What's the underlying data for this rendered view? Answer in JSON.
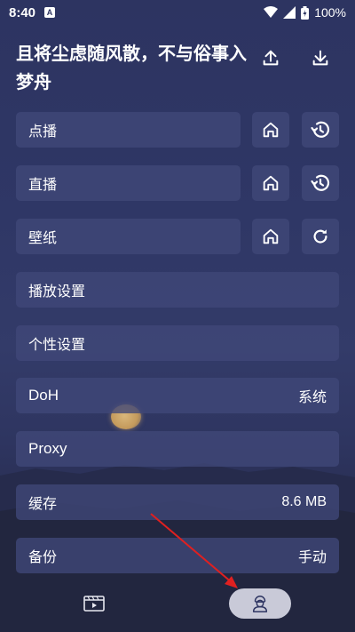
{
  "status_bar": {
    "time": "8:40",
    "notification_letter": "A",
    "battery": "100%"
  },
  "header": {
    "title": "且将尘虑随风散，不与俗事入梦舟",
    "upload_icon": "upload-icon",
    "download_icon": "download-icon"
  },
  "rows": [
    {
      "label": "点播",
      "icons": [
        "home-icon",
        "history-icon"
      ]
    },
    {
      "label": "直播",
      "icons": [
        "home-icon",
        "history-icon"
      ]
    },
    {
      "label": "壁纸",
      "icons": [
        "home-icon",
        "refresh-icon"
      ]
    },
    {
      "label": "播放设置"
    },
    {
      "label": "个性设置"
    },
    {
      "label": "DoH",
      "value": "系统"
    },
    {
      "label": "Proxy",
      "value": ""
    },
    {
      "label": "缓存",
      "value": "8.6 MB"
    },
    {
      "label": "备份",
      "value": "手动"
    }
  ],
  "bottom_nav": {
    "items": [
      "video-tab-icon",
      "settings-tab-icon"
    ],
    "active_index": 1
  },
  "colors": {
    "background": "#2f3766",
    "row_background": "#404878",
    "active_tab": "#c9cad8",
    "arrow": "#e02020"
  }
}
